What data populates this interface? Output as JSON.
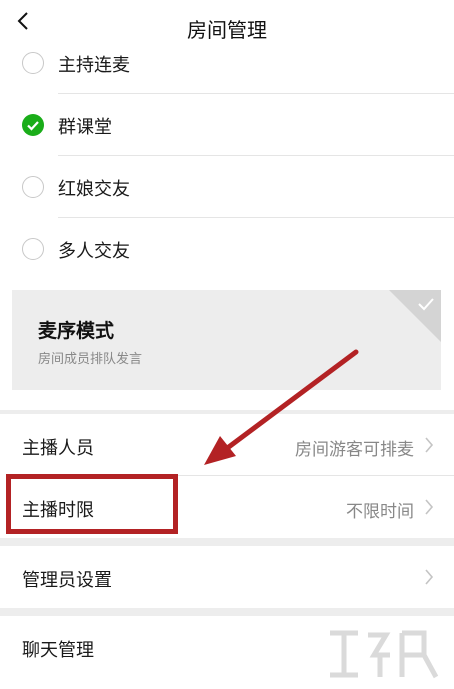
{
  "header": {
    "back_icon": "chevron-left-icon",
    "title": "房间管理"
  },
  "options": [
    {
      "label": "主持连麦",
      "checked": false
    },
    {
      "label": "群课堂",
      "checked": true
    },
    {
      "label": "红娘交友",
      "checked": false
    },
    {
      "label": "多人交友",
      "checked": false
    }
  ],
  "mode_card": {
    "title": "麦序模式",
    "subtitle": "房间成员排队发言",
    "selected": true
  },
  "settings": [
    {
      "label": "主播人员",
      "value": "房间游客可排麦"
    },
    {
      "label": "主播时限",
      "value": "不限时间"
    },
    {
      "label": "管理员设置",
      "value": ""
    },
    {
      "label": "聊天管理",
      "value": ""
    }
  ],
  "annotation": {
    "highlight_color": "#b32224",
    "arrow_color": "#b32224"
  },
  "colors": {
    "accent_green": "#1aad19",
    "background": "#ededed"
  }
}
